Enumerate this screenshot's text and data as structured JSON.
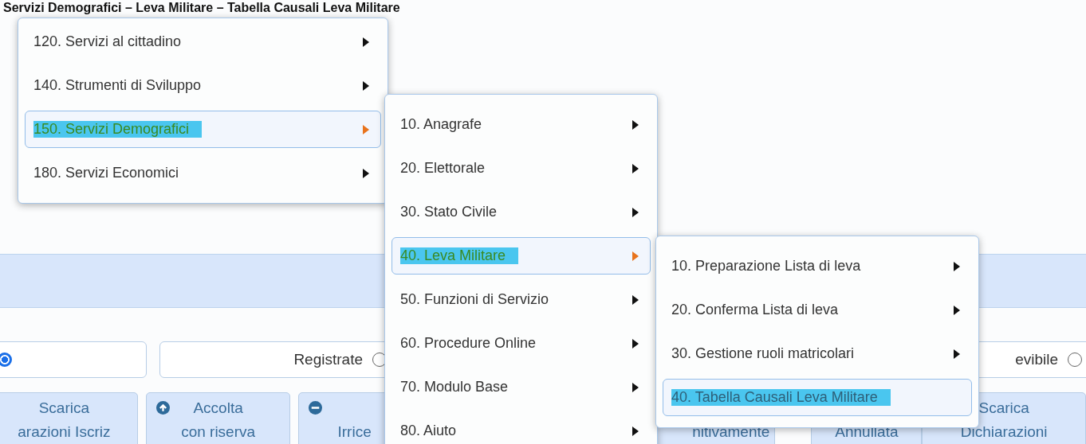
{
  "breadcrumb": "Servizi Demografici – Leva Militare – Tabella Causali Leva Militare",
  "menus": [
    {
      "items": [
        {
          "label": "120. Servizi al cittadino",
          "selected": false,
          "submenu": true
        },
        {
          "label": "140. Strumenti di Sviluppo",
          "selected": false,
          "submenu": true
        },
        {
          "label": "150. Servizi Demografici",
          "selected": true,
          "submenu": true
        },
        {
          "label": "180. Servizi Economici",
          "selected": false,
          "submenu": true
        }
      ]
    },
    {
      "items": [
        {
          "label": "10. Anagrafe",
          "selected": false,
          "submenu": true
        },
        {
          "label": "20. Elettorale",
          "selected": false,
          "submenu": true
        },
        {
          "label": "30. Stato Civile",
          "selected": false,
          "submenu": true
        },
        {
          "label": "40. Leva Militare",
          "selected": true,
          "submenu": true
        },
        {
          "label": "50. Funzioni di Servizio",
          "selected": false,
          "submenu": true
        },
        {
          "label": "60. Procedure Online",
          "selected": false,
          "submenu": true
        },
        {
          "label": "70. Modulo Base",
          "selected": false,
          "submenu": true
        },
        {
          "label": "80. Aiuto",
          "selected": false,
          "submenu": true
        }
      ]
    },
    {
      "items": [
        {
          "label": "10. Preparazione Lista di leva",
          "selected": false,
          "submenu": true
        },
        {
          "label": "20. Conferma Lista di leva",
          "selected": false,
          "submenu": true
        },
        {
          "label": "30. Gestione ruoli matricolari",
          "selected": false,
          "submenu": true
        },
        {
          "label": "40. Tabella Causali Leva Militare",
          "selected": true,
          "submenu": false
        }
      ]
    }
  ],
  "filters": [
    {
      "label": "Registrate",
      "selected": false
    },
    {
      "label": "evibile",
      "selected": false
    }
  ],
  "first_filter": {
    "selected": true
  },
  "buttons": [
    {
      "lines": [
        "Scarica",
        "arazioni Iscriz"
      ],
      "kind": "plain"
    },
    {
      "lines": [
        "Accolta",
        "con riserva"
      ],
      "kind": "accept"
    },
    {
      "lines": [
        "Irrice"
      ],
      "kind": "reject"
    },
    {
      "lines": [
        "nitivamente"
      ],
      "kind": "plain"
    },
    {
      "lines": [
        "Annullata"
      ],
      "kind": "plain"
    },
    {
      "lines": [
        "Scarica",
        "Dichiarazioni"
      ],
      "kind": "plain"
    }
  ]
}
